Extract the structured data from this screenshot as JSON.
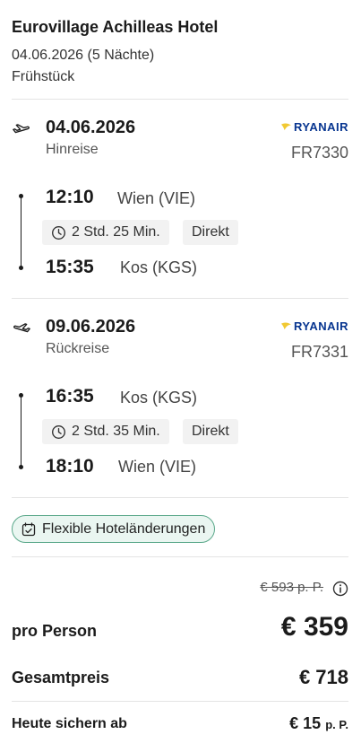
{
  "hotel": {
    "name": "Eurovillage Achilleas Hotel",
    "stay": "04.06.2026 (5 Nächte)",
    "board": "Frühstück"
  },
  "flights": [
    {
      "icon": "departure-plane-icon",
      "date": "04.06.2026",
      "direction": "Hinreise",
      "airline": "RYANAIR",
      "flight_no": "FR7330",
      "dep_time": "12:10",
      "dep_place": "Wien (VIE)",
      "duration": "2 Std. 25 Min.",
      "stops": "Direkt",
      "arr_time": "15:35",
      "arr_place": "Kos (KGS)"
    },
    {
      "icon": "return-plane-icon",
      "date": "09.06.2026",
      "direction": "Rückreise",
      "airline": "RYANAIR",
      "flight_no": "FR7331",
      "dep_time": "16:35",
      "dep_place": "Kos (KGS)",
      "duration": "2 Std. 35 Min.",
      "stops": "Direkt",
      "arr_time": "18:10",
      "arr_place": "Wien (VIE)"
    }
  ],
  "badge": {
    "label": "Flexible Hoteländerungen",
    "icon": "calendar-check-icon"
  },
  "pricing": {
    "old_price": "€ 593 p. P.",
    "per_person_label": "pro Person",
    "per_person_value": "€ 359",
    "total_label": "Gesamtpreis",
    "total_value": "€ 718",
    "deposit_label": "Heute sichern ab",
    "deposit_value": "€ 15",
    "deposit_unit": "p. P."
  },
  "colors": {
    "brand_blue": "#073590",
    "brand_yellow": "#f1c933",
    "badge_green": "#5aa88a"
  }
}
